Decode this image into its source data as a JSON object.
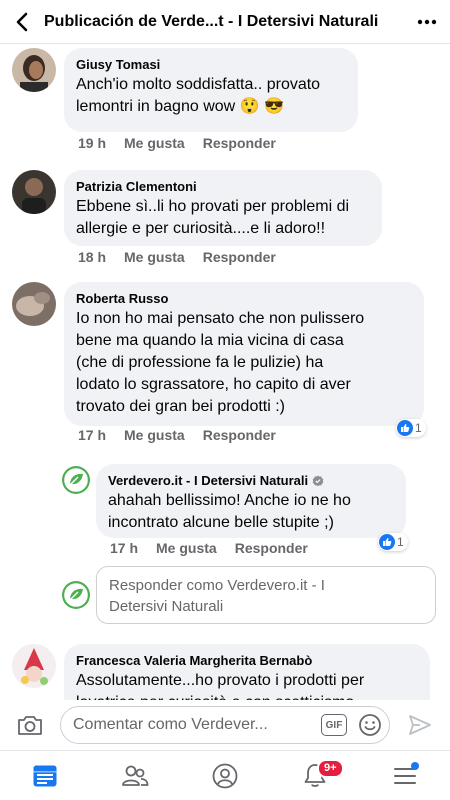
{
  "header": {
    "title": "Publicación de Verde...t -  I Detersivi Naturali"
  },
  "comments": [
    {
      "author": "Giusy Tomasi",
      "text_lines": [
        "Anch'io molto soddisfatta.. provato",
        "lemontri in bagno wow 😲 😎"
      ],
      "time": "19 h",
      "like": "Me gusta",
      "reply": "Responder"
    },
    {
      "author": "Patrizia Clementoni",
      "text_lines": [
        "Ebbene sì..li ho provati per problemi di",
        "allergie e per curiosità....e li adoro!!"
      ],
      "time": "18 h",
      "like": "Me gusta",
      "reply": "Responder"
    },
    {
      "author": "Roberta Russo",
      "text_lines": [
        "Io non ho mai pensato che non pulissero",
        "bene ma quando la mia vicina di casa",
        "(che di professione fa le pulizie) ha",
        "lodato lo sgrassatore, ho capito di aver",
        "trovato dei gran bei prodotti :)"
      ],
      "time": "17 h",
      "like": "Me gusta",
      "reply": "Responder",
      "reactions": "1"
    },
    {
      "author": "Verdevero.it -  I Detersivi Naturali",
      "text_lines": [
        "ahahah bellissimo! Anche io ne ho",
        "incontrato alcune belle stupite ;)"
      ],
      "time": "17 h",
      "like": "Me gusta",
      "reply": "Responder",
      "reactions": "1"
    },
    {
      "author": "Francesca Valeria Margherita Bernabò",
      "text_lines": [
        "Assolutamente...ho provato i prodotti per",
        "lavatrice per curiosità e con scetticismo"
      ]
    }
  ],
  "reply_box": {
    "lines": [
      "Responder como Verdevero.it -  I",
      "Detersivi Naturali"
    ]
  },
  "composer": {
    "placeholder": "Comentar como Verdever...",
    "gif_label": "GIF"
  },
  "nav": {
    "notifications_badge": "9+"
  },
  "colors": {
    "accent": "#1877f2",
    "brand_green": "#4caf50",
    "badge_red": "#e41e3f",
    "bubble": "#f0f2f5",
    "meta_gray": "#65676b"
  },
  "icons": [
    "back-arrow-icon",
    "more-icon",
    "like-icon",
    "verified-icon",
    "camera-icon",
    "gif-icon",
    "emoji-icon",
    "send-icon",
    "feed-icon",
    "friends-icon",
    "profile-icon",
    "bell-icon",
    "menu-icon"
  ]
}
